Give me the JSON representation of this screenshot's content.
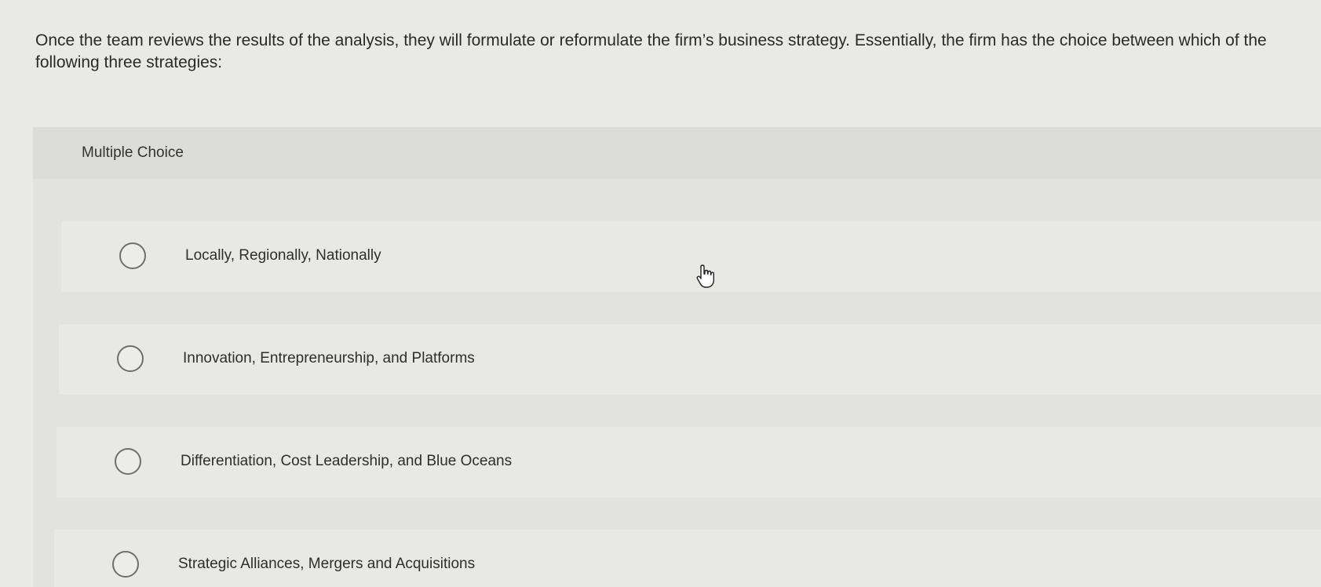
{
  "question": {
    "text": "Once the team reviews the results of the analysis, they will formulate or reformulate the firm’s business strategy. Essentially, the firm has the choice between which of the following three strategies:"
  },
  "multiple_choice": {
    "label": "Multiple Choice",
    "options": [
      {
        "label": "Locally, Regionally, Nationally",
        "selected": false
      },
      {
        "label": "Innovation, Entrepreneurship, and Platforms",
        "selected": false
      },
      {
        "label": "Differentiation, Cost Leadership, and Blue Oceans",
        "selected": false
      },
      {
        "label": "Strategic Alliances, Mergers and Acquisitions",
        "selected": false
      }
    ]
  },
  "icons": {
    "radio": "radio-button-icon",
    "cursor": "hand-pointer-cursor-icon"
  }
}
